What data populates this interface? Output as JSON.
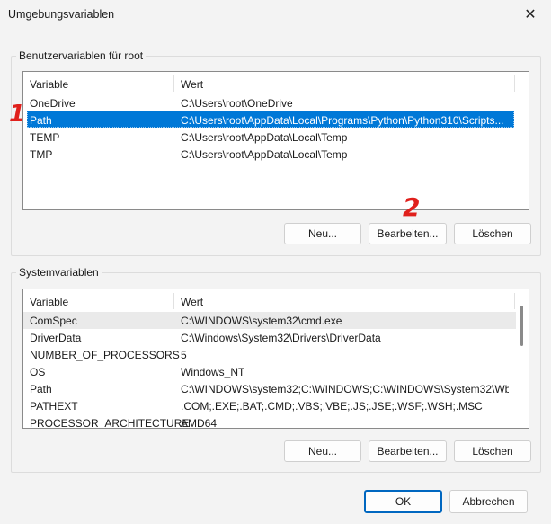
{
  "window": {
    "title": "Umgebungsvariablen",
    "close_glyph": "✕"
  },
  "user_group": {
    "label": "Benutzervariablen für root",
    "columns": [
      "Variable",
      "Wert"
    ],
    "rows": [
      {
        "name": "OneDrive",
        "value": "C:\\Users\\root\\OneDrive"
      },
      {
        "name": "Path",
        "value": "C:\\Users\\root\\AppData\\Local\\Programs\\Python\\Python310\\Scripts..."
      },
      {
        "name": "TEMP",
        "value": "C:\\Users\\root\\AppData\\Local\\Temp"
      },
      {
        "name": "TMP",
        "value": "C:\\Users\\root\\AppData\\Local\\Temp"
      }
    ],
    "selected_row": "Path",
    "buttons": {
      "new": "Neu...",
      "edit": "Bearbeiten...",
      "delete": "Löschen"
    }
  },
  "system_group": {
    "label": "Systemvariablen",
    "columns": [
      "Variable",
      "Wert"
    ],
    "rows": [
      {
        "name": "ComSpec",
        "value": "C:\\WINDOWS\\system32\\cmd.exe"
      },
      {
        "name": "DriverData",
        "value": "C:\\Windows\\System32\\Drivers\\DriverData"
      },
      {
        "name": "NUMBER_OF_PROCESSORS",
        "value": "5"
      },
      {
        "name": "OS",
        "value": "Windows_NT"
      },
      {
        "name": "Path",
        "value": "C:\\WINDOWS\\system32;C:\\WINDOWS;C:\\WINDOWS\\System32\\Wb..."
      },
      {
        "name": "PATHEXT",
        "value": ".COM;.EXE;.BAT;.CMD;.VBS;.VBE;.JS;.JSE;.WSF;.WSH;.MSC"
      },
      {
        "name": "PROCESSOR_ARCHITECTURE",
        "value": "AMD64"
      }
    ],
    "buttons": {
      "new": "Neu...",
      "edit": "Bearbeiten...",
      "delete": "Löschen"
    }
  },
  "footer": {
    "ok": "OK",
    "cancel": "Abbrechen"
  },
  "annotations": {
    "first": "1",
    "second": "2"
  },
  "colors": {
    "selection": "#0078d7",
    "annotation": "#e0201c",
    "primary_border": "#0067c0"
  }
}
